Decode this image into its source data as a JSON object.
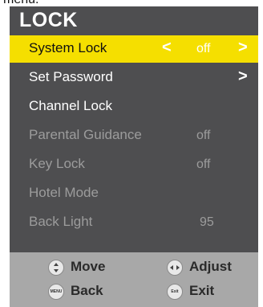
{
  "top_caption": "menu.",
  "menu": {
    "title": "LOCK",
    "rows": [
      {
        "label": "System Lock",
        "value": "off",
        "left_arrow": "<",
        "right_arrow": ">",
        "selected": true
      },
      {
        "label": "Set Password",
        "value": "",
        "right_arrow": ">"
      },
      {
        "label": "Channel Lock",
        "value": ""
      },
      {
        "label": "Parental Guidance",
        "value": "off",
        "disabled": true
      },
      {
        "label": "Key Lock",
        "value": "off",
        "disabled": true
      },
      {
        "label": "Hotel Mode",
        "value": "",
        "disabled": true
      },
      {
        "label": "Back Light",
        "value": "95",
        "disabled": true
      }
    ]
  },
  "footer": {
    "move": "Move",
    "adjust": "Adjust",
    "back": "Back",
    "exit": "Exit",
    "menu_key_text": "MENU",
    "exit_key_text": "Exit"
  },
  "colors": {
    "highlight": "#f5df00",
    "panel": "#4e4e50",
    "footer": "#a8a8a8",
    "disabled_text": "#9c9c9c"
  },
  "icons": {
    "move": "up-down-arrows-icon",
    "adjust": "left-right-arrows-icon",
    "back": "menu-key-icon",
    "exit": "exit-key-icon"
  }
}
